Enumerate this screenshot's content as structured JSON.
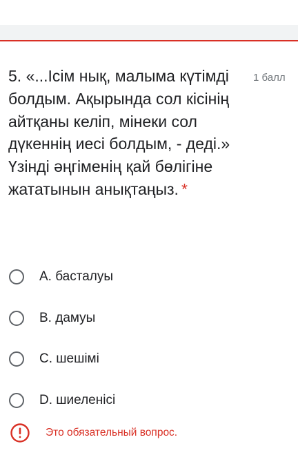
{
  "question": {
    "number_and_text": "5. «...Ісім нық, малыма күтімді болдым. Ақырында сол кісінің айтқаны келіп, мінеки сол дүкеннің иесі болдым, - деді.» Үзінді әңгіменің қай бөлігіне жататынын анықтаңыз.",
    "required_marker": "*",
    "points": "1 балл"
  },
  "options": [
    {
      "label": "A. басталуы",
      "selected": false
    },
    {
      "label": "B. дамуы",
      "selected": false
    },
    {
      "label": "C. шешімі",
      "selected": false
    },
    {
      "label": "D. шиеленісі",
      "selected": false
    }
  ],
  "validation": {
    "icon": "alert-circle-icon",
    "message": "Это обязательный вопрос."
  },
  "colors": {
    "error": "#d93025",
    "text": "#202124",
    "muted": "#70757a",
    "radio_border": "#5f6368"
  }
}
